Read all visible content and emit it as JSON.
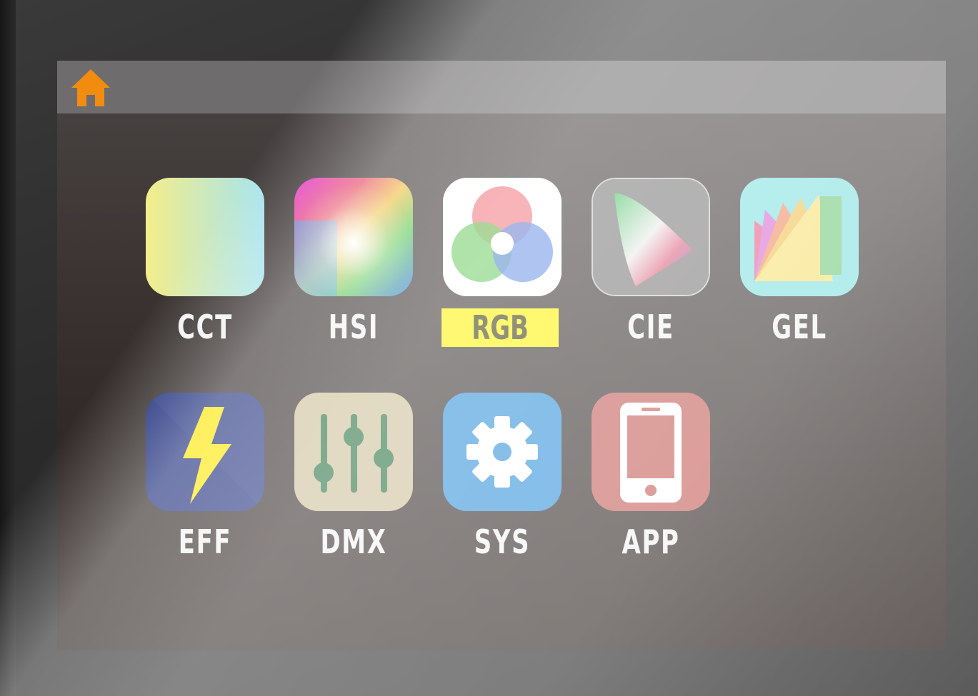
{
  "header": {
    "home_icon": "home-icon",
    "home_icon_color": "#f28c0f"
  },
  "apps": [
    {
      "id": "cct",
      "label": "CCT",
      "icon": "cct-gradient-icon",
      "selected": false
    },
    {
      "id": "hsi",
      "label": "HSI",
      "icon": "hsi-color-wheel-icon",
      "selected": false
    },
    {
      "id": "rgb",
      "label": "RGB",
      "icon": "rgb-circles-icon",
      "selected": true
    },
    {
      "id": "cie",
      "label": "CIE",
      "icon": "cie-chromaticity-icon",
      "selected": false
    },
    {
      "id": "gel",
      "label": "GEL",
      "icon": "gel-swatch-fan-icon",
      "selected": false
    },
    {
      "id": "eff",
      "label": "EFF",
      "icon": "lightning-bolt-icon",
      "selected": false
    },
    {
      "id": "dmx",
      "label": "DMX",
      "icon": "fader-sliders-icon",
      "selected": false
    },
    {
      "id": "sys",
      "label": "SYS",
      "icon": "gear-icon",
      "selected": false
    },
    {
      "id": "app",
      "label": "APP",
      "icon": "smartphone-icon",
      "selected": false
    }
  ],
  "colors": {
    "selection_highlight": "#fff200",
    "label_text": "#f2f2f2",
    "sys_tile": "#2a8ed8",
    "eff_tile": "#1a2a7a",
    "dmx_tile": "#cbbd94",
    "app_tile": "#c25a54"
  }
}
